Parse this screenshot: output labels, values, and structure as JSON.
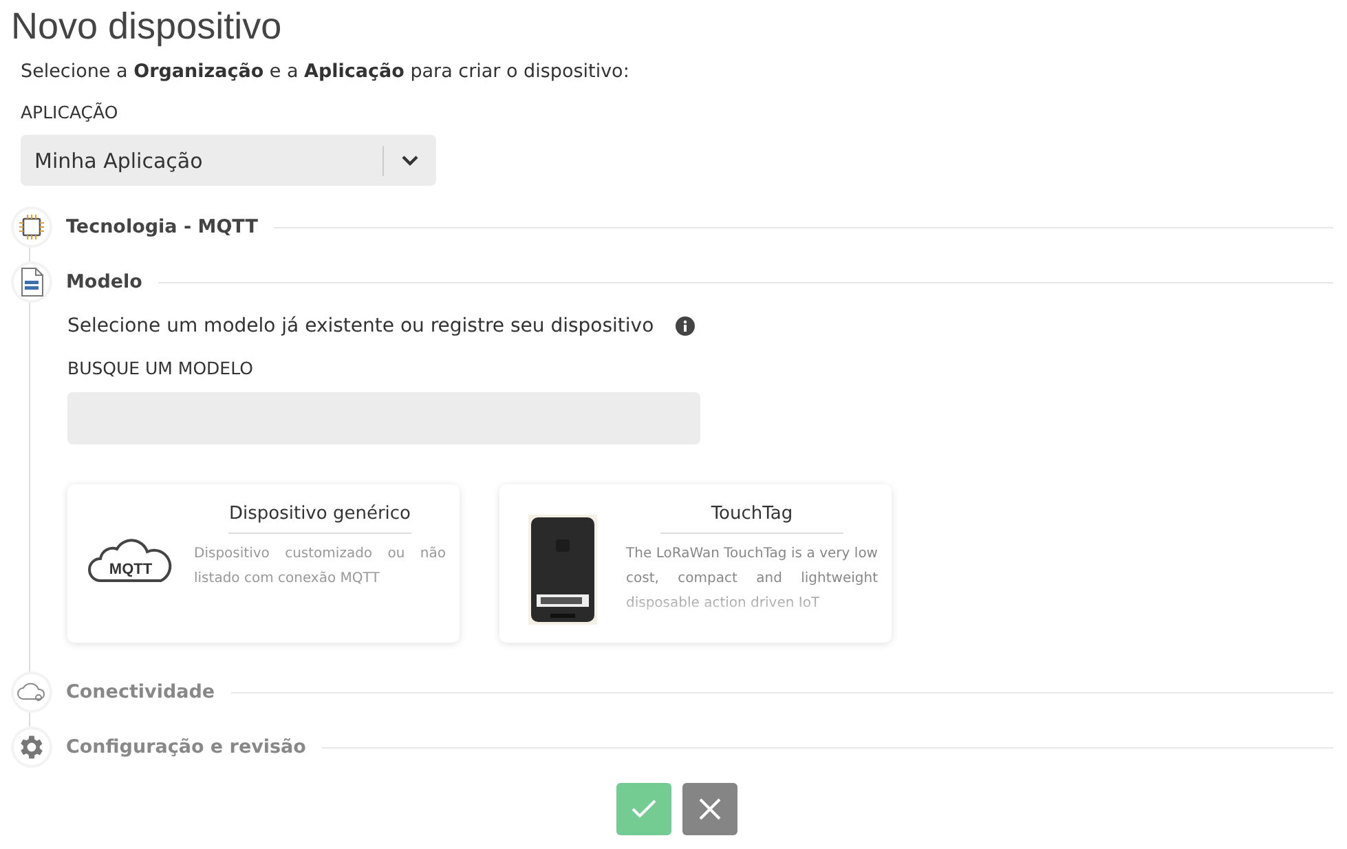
{
  "title": "Novo dispositivo",
  "intro": "Selecione a **Organização** e a **Aplicação** para criar o dispositivo:",
  "application": {
    "label": "APLICAÇÃO",
    "value": "Minha Aplicação"
  },
  "steps": [
    {
      "kind": "chip",
      "title": "Tecnologia - MQTT",
      "active": true
    },
    {
      "kind": "binary",
      "title": "Modelo",
      "active": true,
      "content": {
        "prompt": "Selecione um modelo já existente ou registre seu dispositivo",
        "search_label": "BUSQUE UM MODELO",
        "cards": [
          {
            "kind": "mqtt",
            "icon_label": "MQTT",
            "title": "Dispositivo genérico",
            "description": "Dispositivo customizado ou não listado com conexão MQTT"
          },
          {
            "kind": "picture",
            "title": "TouchTag",
            "description": "The LoRaWan TouchTag is a very low cost, compact and lightweight disposable action driven IoT"
          }
        ]
      }
    },
    {
      "kind": "cloud",
      "title": "Conectividade",
      "active": false
    },
    {
      "kind": "gear",
      "title": "Configuração e revisão",
      "active": false
    }
  ],
  "actions": [
    {
      "kind": "confirm"
    },
    {
      "kind": "cancel"
    }
  ]
}
